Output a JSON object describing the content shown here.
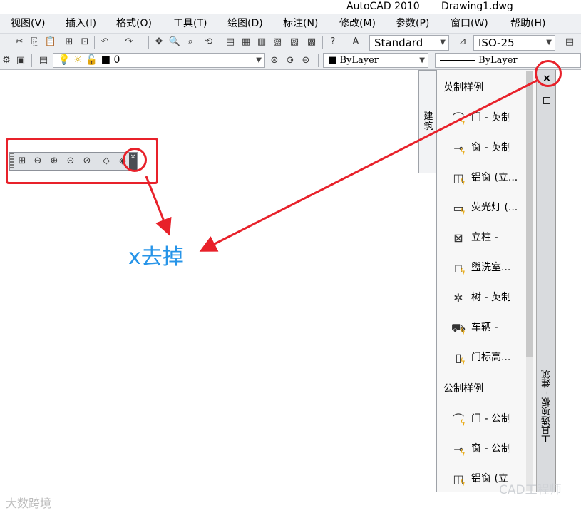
{
  "window": {
    "app_name": "AutoCAD 2010",
    "document": "Drawing1.dwg"
  },
  "menu": [
    "视图(V)",
    "插入(I)",
    "格式(O)",
    "工具(T)",
    "绘图(D)",
    "标注(N)",
    "修改(M)",
    "参数(P)",
    "窗口(W)",
    "帮助(H)"
  ],
  "toolbar": {
    "text_style": "Standard",
    "dim_style": "ISO-25"
  },
  "layers": {
    "current_layer": "0",
    "color": "ByLayer",
    "linetype": "ByLayer"
  },
  "annotation": {
    "label": "x去掉"
  },
  "palette": {
    "tab_label": "建筑",
    "title": "工具选项板 - 建筑",
    "close_glyph": "×",
    "sections": [
      {
        "title": "英制样例",
        "items": [
          "门 - 英制",
          "窗 - 英制",
          "铝窗 (立...",
          "荧光灯 (...",
          "立柱 -",
          "盥洗室...",
          "树 - 英制",
          "车辆 -",
          "门标高..."
        ]
      },
      {
        "title": "公制样例",
        "items": [
          "门 - 公制",
          "窗 - 公制",
          "铝窗 (立"
        ]
      }
    ]
  },
  "watermark": {
    "left": "大数跨境",
    "right": "CAD工程师"
  },
  "colors": {
    "annotation_red": "#e8212a",
    "annotation_blue": "#2694e8"
  }
}
